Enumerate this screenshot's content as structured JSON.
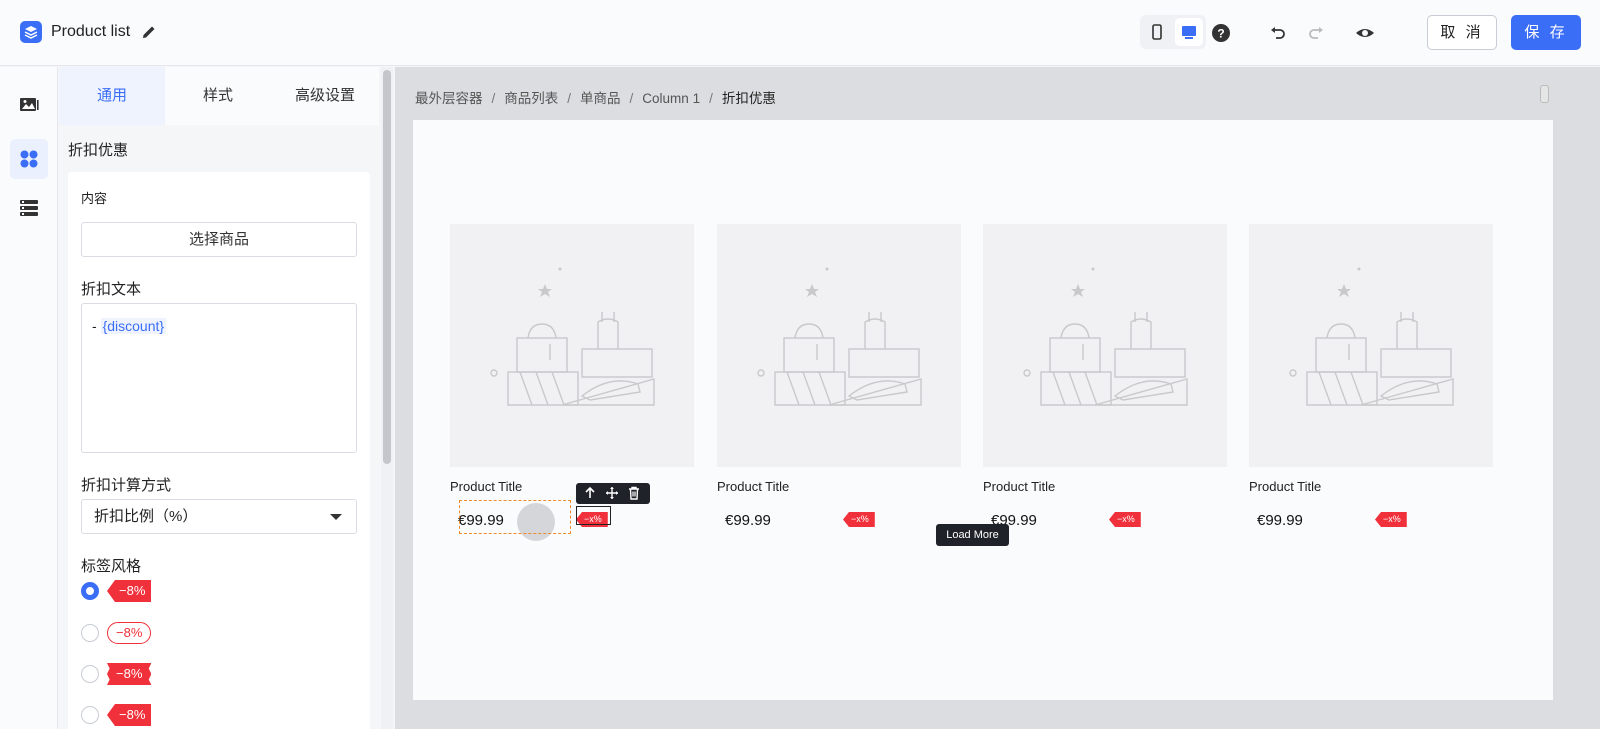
{
  "header": {
    "title": "Product list",
    "cancel_label": "取 消",
    "save_label": "保 存"
  },
  "rail": {
    "items": [
      "image-icon",
      "components-icon",
      "layers-icon"
    ],
    "active_index": 1
  },
  "panel": {
    "tabs": [
      {
        "label": "通用",
        "active": true
      },
      {
        "label": "样式",
        "active": false
      },
      {
        "label": "高级设置",
        "active": false
      }
    ],
    "section_title": "折扣优惠",
    "content_label": "内容",
    "select_product_label": "选择商品",
    "discount_text_label": "折扣文本",
    "discount_text_prefix": "- ",
    "discount_text_token": "{discount}",
    "calc_method_label": "折扣计算方式",
    "calc_method_value": "折扣比例（%）",
    "tag_style_label": "标签风格",
    "tag_styles": [
      {
        "text": "−8%",
        "selected": true
      },
      {
        "text": "−8%",
        "selected": false
      },
      {
        "text": "−8%",
        "selected": false
      },
      {
        "text": "−8%",
        "selected": false
      }
    ]
  },
  "canvas": {
    "breadcrumb": [
      "最外层容器",
      "商品列表",
      "单商品",
      "Column 1",
      "折扣优惠"
    ],
    "products": [
      {
        "title": "Product Title",
        "price": "€99.99",
        "badge": "−x%"
      },
      {
        "title": "Product Title",
        "price": "€99.99",
        "badge": "−x%"
      },
      {
        "title": "Product Title",
        "price": "€99.99",
        "badge": "−x%"
      },
      {
        "title": "Product Title",
        "price": "€99.99",
        "badge": "−x%"
      }
    ],
    "load_more_label": "Load More"
  },
  "colors": {
    "accent": "#3b6ef6",
    "badge_red": "#f0303a",
    "selection_orange": "#f08a2c"
  }
}
